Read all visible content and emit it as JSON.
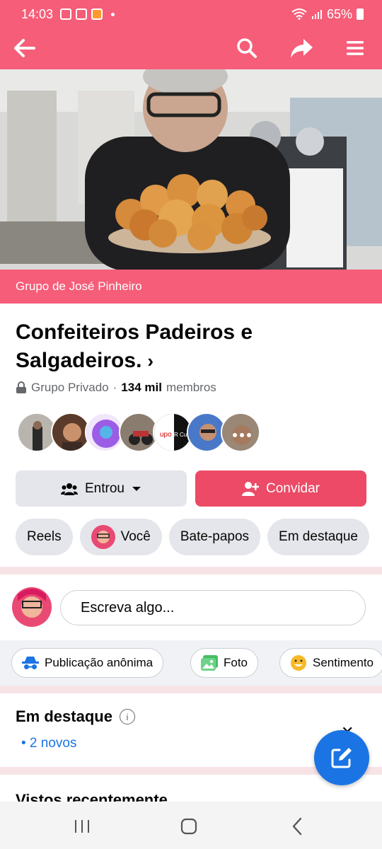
{
  "status_bar": {
    "time": "14:03",
    "battery": "65%"
  },
  "app_bar": {
    "back_icon": "back-arrow-icon",
    "search_icon": "search-icon",
    "share_icon": "share-icon",
    "menu_icon": "menu-icon"
  },
  "cover": {
    "owner_label": "Grupo de José Pinheiro"
  },
  "group": {
    "title": "Confeiteiros  Padeiros e Salgadeiros.",
    "privacy": "Grupo Privado",
    "separator": "·",
    "members_count": "134 mil",
    "members_label": "membros"
  },
  "actions": {
    "joined_label": "Entrou",
    "invite_label": "Convidar"
  },
  "chips": [
    {
      "label": "Reels"
    },
    {
      "label": "Você"
    },
    {
      "label": "Bate-papos"
    },
    {
      "label": "Em destaque"
    }
  ],
  "composer": {
    "placeholder": "Escreva algo..."
  },
  "post_options": [
    {
      "label": "Publicação anônima"
    },
    {
      "label": "Foto"
    },
    {
      "label": "Sentimento"
    }
  ],
  "featured": {
    "title": "Em destaque",
    "new_count": "• 2 novos"
  },
  "recent": {
    "title": "Vistos recentemente"
  },
  "colors": {
    "brand": "#f65d78",
    "invite": "#ec4a66",
    "link": "#1b74e4"
  }
}
